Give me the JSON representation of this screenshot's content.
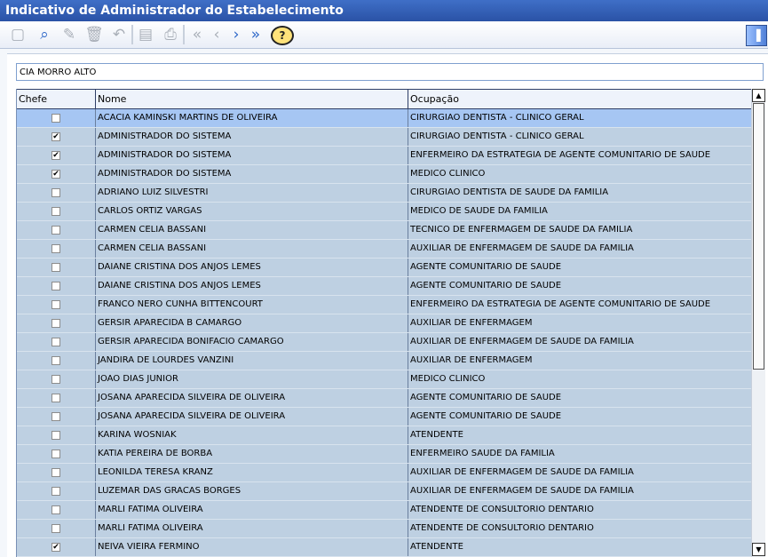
{
  "window": {
    "title": "Indicativo de Administrador do Estabelecimento"
  },
  "toolbar": {
    "buttons": [
      {
        "name": "new-icon",
        "glyph": "▢"
      },
      {
        "name": "find-icon",
        "glyph": "⌕"
      },
      {
        "name": "edit-icon",
        "glyph": "✎"
      },
      {
        "name": "delete-icon",
        "glyph": "🗑"
      },
      {
        "name": "undo-icon",
        "glyph": "↶"
      },
      {
        "name": "save-icon",
        "glyph": "▤"
      },
      {
        "name": "print-icon",
        "glyph": "⎙"
      },
      {
        "name": "first-icon",
        "glyph": "«"
      },
      {
        "name": "previous-icon",
        "glyph": "‹"
      },
      {
        "name": "next-icon",
        "glyph": "›"
      },
      {
        "name": "last-icon",
        "glyph": "»"
      },
      {
        "name": "help-icon",
        "glyph": "?"
      }
    ],
    "exit_glyph": "▐"
  },
  "establishment": {
    "value": "CIA MORRO ALTO"
  },
  "table": {
    "columns": [
      "Chefe",
      "Nome",
      "Ocupação"
    ],
    "rows": [
      {
        "chefe": false,
        "nome": "ACACIA KAMINSKI MARTINS DE OLIVEIRA",
        "ocupacao": "CIRURGIAO DENTISTA - CLINICO GERAL",
        "selected": true
      },
      {
        "chefe": true,
        "nome": "ADMINISTRADOR DO SISTEMA",
        "ocupacao": "CIRURGIAO DENTISTA - CLINICO GERAL"
      },
      {
        "chefe": true,
        "nome": "ADMINISTRADOR DO SISTEMA",
        "ocupacao": "ENFERMEIRO DA ESTRATEGIA DE AGENTE COMUNITARIO DE SAUDE"
      },
      {
        "chefe": true,
        "nome": "ADMINISTRADOR DO SISTEMA",
        "ocupacao": "MEDICO CLINICO"
      },
      {
        "chefe": false,
        "nome": "ADRIANO LUIZ SILVESTRI",
        "ocupacao": "CIRURGIAO DENTISTA DE SAUDE DA FAMILIA"
      },
      {
        "chefe": false,
        "nome": "CARLOS ORTIZ VARGAS",
        "ocupacao": "MEDICO DE SAUDE DA FAMILIA"
      },
      {
        "chefe": false,
        "nome": "CARMEN CELIA BASSANI",
        "ocupacao": "TECNICO DE ENFERMAGEM DE SAUDE DA FAMILIA"
      },
      {
        "chefe": false,
        "nome": "CARMEN CELIA BASSANI",
        "ocupacao": "AUXILIAR DE ENFERMAGEM DE SAUDE DA FAMILIA"
      },
      {
        "chefe": false,
        "nome": "DAIANE CRISTINA DOS ANJOS LEMES",
        "ocupacao": "AGENTE COMUNITARIO DE SAUDE"
      },
      {
        "chefe": false,
        "nome": "DAIANE CRISTINA DOS ANJOS LEMES",
        "ocupacao": "AGENTE COMUNITARIO DE SAUDE"
      },
      {
        "chefe": false,
        "nome": "FRANCO NERO CUNHA BITTENCOURT",
        "ocupacao": "ENFERMEIRO DA ESTRATEGIA DE AGENTE COMUNITARIO DE SAUDE"
      },
      {
        "chefe": false,
        "nome": "GERSIR APARECIDA B CAMARGO",
        "ocupacao": "AUXILIAR DE ENFERMAGEM"
      },
      {
        "chefe": false,
        "nome": "GERSIR APARECIDA BONIFACIO CAMARGO",
        "ocupacao": "AUXILIAR DE ENFERMAGEM DE SAUDE DA FAMILIA"
      },
      {
        "chefe": false,
        "nome": "JANDIRA DE LOURDES VANZINI",
        "ocupacao": "AUXILIAR DE ENFERMAGEM"
      },
      {
        "chefe": false,
        "nome": "JOAO DIAS JUNIOR",
        "ocupacao": "MEDICO CLINICO"
      },
      {
        "chefe": false,
        "nome": "JOSANA APARECIDA SILVEIRA DE OLIVEIRA",
        "ocupacao": "AGENTE COMUNITARIO DE SAUDE"
      },
      {
        "chefe": false,
        "nome": "JOSANA APARECIDA SILVEIRA DE OLIVEIRA",
        "ocupacao": "AGENTE COMUNITARIO DE SAUDE"
      },
      {
        "chefe": false,
        "nome": "KARINA WOSNIAK",
        "ocupacao": "ATENDENTE"
      },
      {
        "chefe": false,
        "nome": "KATIA PEREIRA DE BORBA",
        "ocupacao": "ENFERMEIRO SAUDE DA FAMILIA"
      },
      {
        "chefe": false,
        "nome": "LEONILDA TERESA KRANZ",
        "ocupacao": "AUXILIAR DE ENFERMAGEM DE SAUDE DA FAMILIA"
      },
      {
        "chefe": false,
        "nome": "LUZEMAR DAS GRACAS BORGES",
        "ocupacao": "AUXILIAR DE ENFERMAGEM DE SAUDE DA FAMILIA"
      },
      {
        "chefe": false,
        "nome": "MARLI FATIMA OLIVEIRA",
        "ocupacao": "ATENDENTE DE CONSULTORIO DENTARIO"
      },
      {
        "chefe": false,
        "nome": "MARLI FATIMA OLIVEIRA",
        "ocupacao": "ATENDENTE DE CONSULTORIO DENTARIO"
      },
      {
        "chefe": true,
        "nome": "NEIVA VIEIRA FERMINO",
        "ocupacao": "ATENDENTE"
      }
    ]
  },
  "scrollbar": {
    "up_glyph": "▲",
    "down_glyph": "▼"
  }
}
